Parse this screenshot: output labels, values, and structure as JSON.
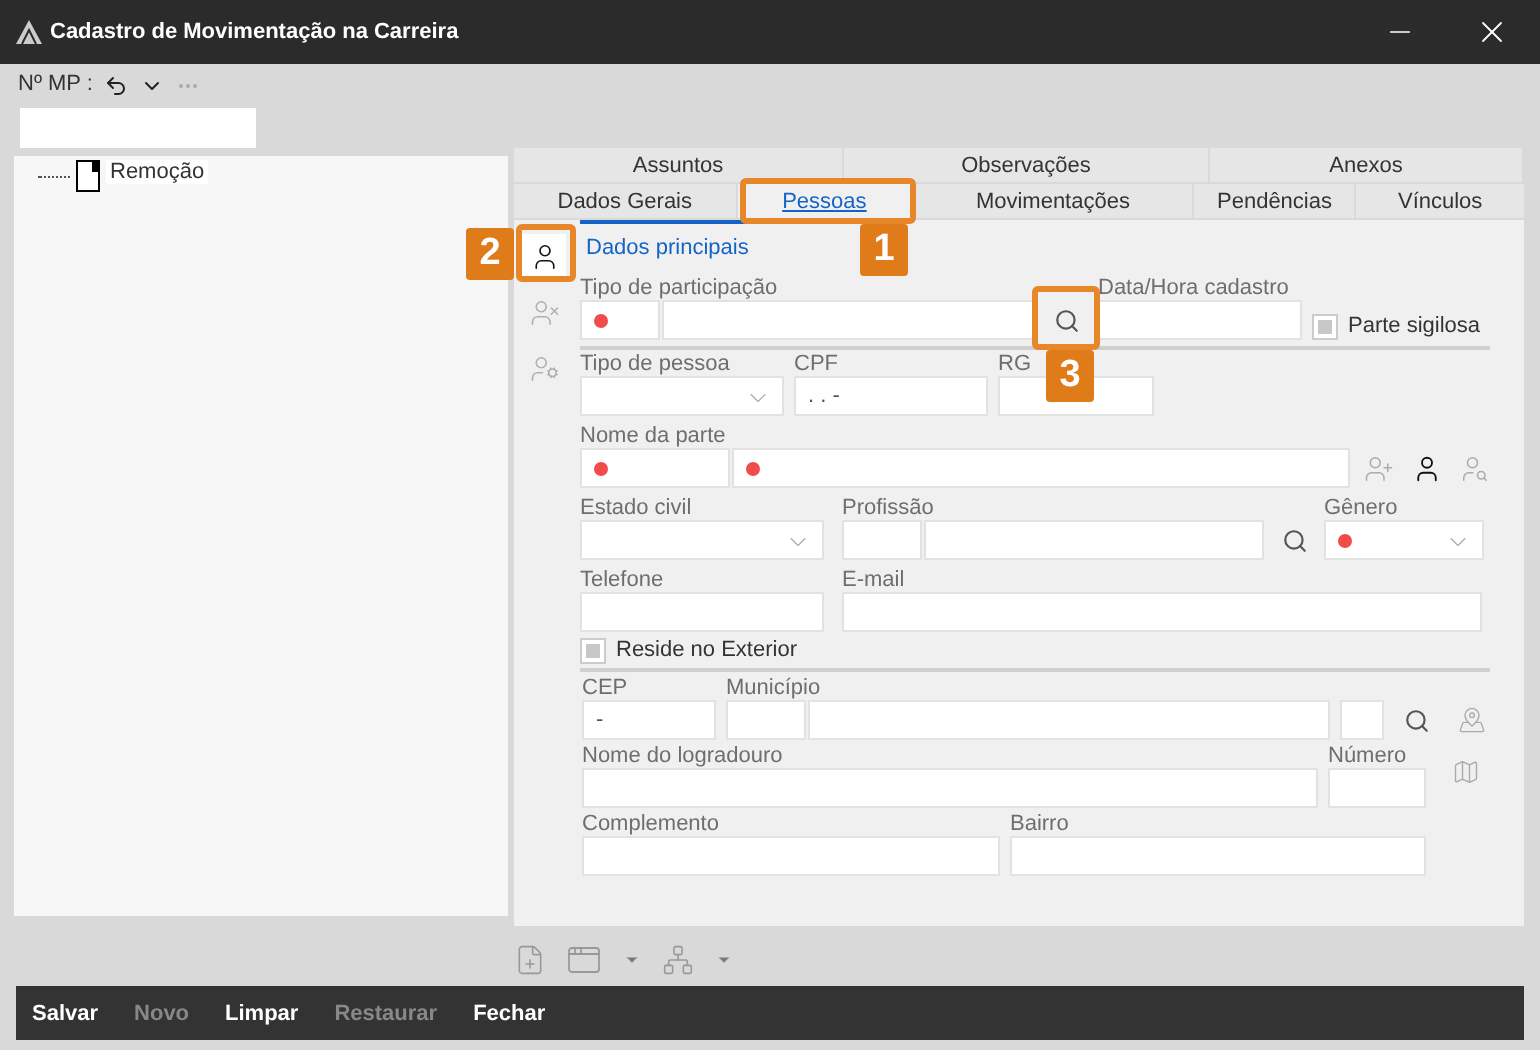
{
  "window": {
    "title": "Cadastro de Movimentação na Carreira"
  },
  "header": {
    "mp_label": "Nº MP :"
  },
  "tree": [
    {
      "label": "Remoção"
    }
  ],
  "tabs_top": [
    {
      "label": "Assuntos",
      "selected": false
    },
    {
      "label": "Observações",
      "selected": false
    },
    {
      "label": "Anexos",
      "selected": false
    }
  ],
  "tabs_bottom": [
    {
      "label": "Dados Gerais",
      "selected": false
    },
    {
      "label": "Pessoas",
      "selected": true
    },
    {
      "label": "Movimentações",
      "selected": false
    },
    {
      "label": "Pendências",
      "selected": false
    },
    {
      "label": "Vínculos",
      "selected": false
    }
  ],
  "side_tools": [
    {
      "selected": true,
      "disabled": false
    },
    {
      "selected": false,
      "disabled": true
    },
    {
      "selected": false,
      "disabled": true
    }
  ],
  "subtab": {
    "label": "Dados principais"
  },
  "form": {
    "participacao": {
      "label": "Tipo de participação",
      "required": true
    },
    "data_hora": {
      "label": "Data/Hora cadastro"
    },
    "parte_sigilosa": {
      "label": "Parte sigilosa",
      "checked": false,
      "disabled": true
    },
    "tipo_pessoa": {
      "label": "Tipo de pessoa"
    },
    "cpf": {
      "label": "CPF",
      "value": ". . -"
    },
    "rg": {
      "label": "RG"
    },
    "nome": {
      "label": "Nome da parte",
      "required": true
    },
    "estado_civil": {
      "label": "Estado civil"
    },
    "profissao": {
      "label": "Profissão"
    },
    "genero": {
      "label": "Gênero",
      "required": true
    },
    "telefone": {
      "label": "Telefone"
    },
    "email": {
      "label": "E-mail"
    },
    "reside_exterior": {
      "label": "Reside no Exterior",
      "checked": false,
      "disabled": true
    },
    "cep": {
      "label": "CEP",
      "value": "-"
    },
    "municipio": {
      "label": "Município"
    },
    "logradouro": {
      "label": "Nome do logradouro"
    },
    "numero": {
      "label": "Número"
    },
    "complemento": {
      "label": "Complemento"
    },
    "bairro": {
      "label": "Bairro"
    }
  },
  "footer_buttons": [
    {
      "label": "Salvar",
      "disabled": false
    },
    {
      "label": "Novo",
      "disabled": true
    },
    {
      "label": "Limpar",
      "disabled": false
    },
    {
      "label": "Restaurar",
      "disabled": true
    },
    {
      "label": "Fechar",
      "disabled": false
    }
  ],
  "callouts": [
    {
      "label": "1"
    },
    {
      "label": "2"
    },
    {
      "label": "3"
    }
  ]
}
